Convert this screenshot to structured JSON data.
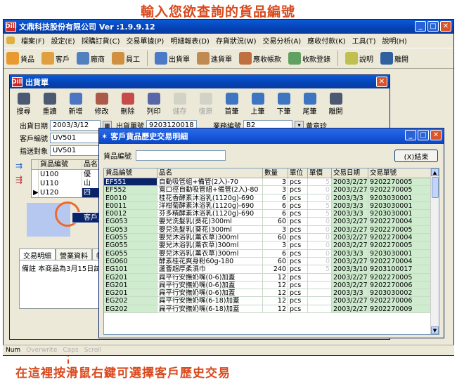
{
  "annotations": {
    "top": "輸入您欲查詢的貨品編號",
    "bottom": "在這裡按滑鼠右鍵可選擇客戶歷史交易"
  },
  "main_window": {
    "icon_text": "Dill",
    "title": "文鼎科技股份有限公司  Ver :1.9.9.12",
    "menu": [
      "檔案(F)",
      "設定(E)",
      "採購訂貨(C)",
      "交易單據(P)",
      "明細報表(D)",
      "存貨狀況(W)",
      "交易分析(A)",
      "應收付款(K)",
      "工具(T)",
      "說明(H)"
    ],
    "toolbar": [
      "貨品",
      "客戶",
      "廠商",
      "員工",
      "出貨單",
      "進貨單",
      "應收帳款",
      "收款登錄",
      "說明",
      "離開"
    ]
  },
  "child_window": {
    "icon_text": "Dill",
    "title": "出貨單",
    "toolbar": [
      "搜尋",
      "重讀",
      "新增",
      "修改",
      "刪除",
      "列印",
      "儲存",
      "復原",
      "首筆",
      "上筆",
      "下筆",
      "尾筆",
      "離開"
    ],
    "disabled": [
      "儲存",
      "復原"
    ],
    "fields": {
      "ship_date_label": "出貨日期",
      "ship_date": "2003/3/12",
      "ship_no_label": "出貨單號",
      "ship_no": "9203120018",
      "sales_no_label": "業務編號",
      "sales_no": "B2",
      "sales_name": "黃意玲",
      "customer_label": "客戶編號",
      "customer": "UV501",
      "target_label": "指送對象",
      "target": "UV501"
    },
    "grid": {
      "headers": [
        "貨品編號",
        "品名"
      ],
      "rows": [
        [
          "U100",
          "優"
        ],
        [
          "U110",
          "山"
        ],
        [
          "U120",
          "四"
        ]
      ]
    },
    "context_menu": "客戶歷史交易",
    "tabs": [
      "交易明細",
      "營業資料",
      "帳"
    ],
    "notes_label": "備註",
    "notes_text": "本商品為3月15日試"
  },
  "status_bar": [
    "Num",
    "Overwrite",
    "Caps",
    "Scroll"
  ],
  "dialog": {
    "title": "客戶貨品歷史交易明細",
    "filter_label": "貨品編號",
    "filter_value": "",
    "close_button": "(X)結束",
    "headers": [
      "貨品編號",
      "品名",
      "數量",
      "單位",
      "單價",
      "交易日期",
      "交易單號"
    ],
    "rows": [
      [
        "EF551",
        "自動吸管組+備管(2入)-70",
        "3",
        "pcs",
        "5",
        "2003/2/27",
        "9202270005"
      ],
      [
        "EF552",
        "寬口徑自動吸管組+備管(2入)-80",
        "3",
        "pcs",
        "0",
        "2003/2/27",
        "9202270005"
      ],
      [
        "E0010",
        "桂花香酵素沐浴乳(1120g)-690",
        "6",
        "pcs",
        "0",
        "2003/3/3",
        "9203030001"
      ],
      [
        "E0011",
        "洋柑菊酵素沐浴乳(1120g)-690",
        "6",
        "pcs",
        "5",
        "2003/3/3",
        "9203030001"
      ],
      [
        "E0012",
        "芬多精酵素沐浴乳(1120g)-690",
        "6",
        "pcs",
        "5",
        "2003/3/3",
        "9203030001"
      ],
      [
        "EG053",
        "嬰兒洗髮乳(葵花)300ml",
        "60",
        "pcs",
        "0",
        "2003/2/27",
        "9202270004"
      ],
      [
        "EG053",
        "嬰兒洗髮乳(葵花)300ml",
        "3",
        "pcs",
        "0",
        "2003/2/27",
        "9202270005"
      ],
      [
        "EG055",
        "嬰兒沐浴乳(薰衣草)300ml",
        "60",
        "pcs",
        "0",
        "2003/2/27",
        "9202270004"
      ],
      [
        "EG055",
        "嬰兒沐浴乳(薰衣草)300ml",
        "3",
        "pcs",
        "0",
        "2003/2/27",
        "9202270005"
      ],
      [
        "EG055",
        "嬰兒沐浴乳(薰衣草)300ml",
        "6",
        "pcs",
        "0",
        "2003/3/3",
        "9203030001"
      ],
      [
        "EG060",
        "酵素桂花爽身粉60g-180",
        "60",
        "pcs",
        "0",
        "2003/2/27",
        "9202270004"
      ],
      [
        "EG101",
        "蘆薈超厚柔濕巾",
        "240",
        "pcs",
        "5",
        "2003/3/10",
        "9203100017"
      ],
      [
        "EG201",
        "扁平行安撫奶嘴(0-6)加蓋",
        "12",
        "pcs",
        "",
        "2003/2/27",
        "9202270005"
      ],
      [
        "EG201",
        "扁平行安撫奶嘴(0-6)加蓋",
        "12",
        "pcs",
        "",
        "2003/2/27",
        "9202270006"
      ],
      [
        "EG201",
        "扁平行安撫奶嘴(0-6)加蓋",
        "12",
        "pcs",
        "",
        "2003/3/3",
        "9203030002"
      ],
      [
        "EG202",
        "扁平行安撫奶嘴(6-18)加蓋",
        "12",
        "pcs",
        "",
        "2003/2/27",
        "9202270006"
      ],
      [
        "EG202",
        "扁平行安撫奶嘴(6-18)加蓋",
        "12",
        "pcs",
        "",
        "2003/2/27",
        "9202270009"
      ]
    ]
  }
}
